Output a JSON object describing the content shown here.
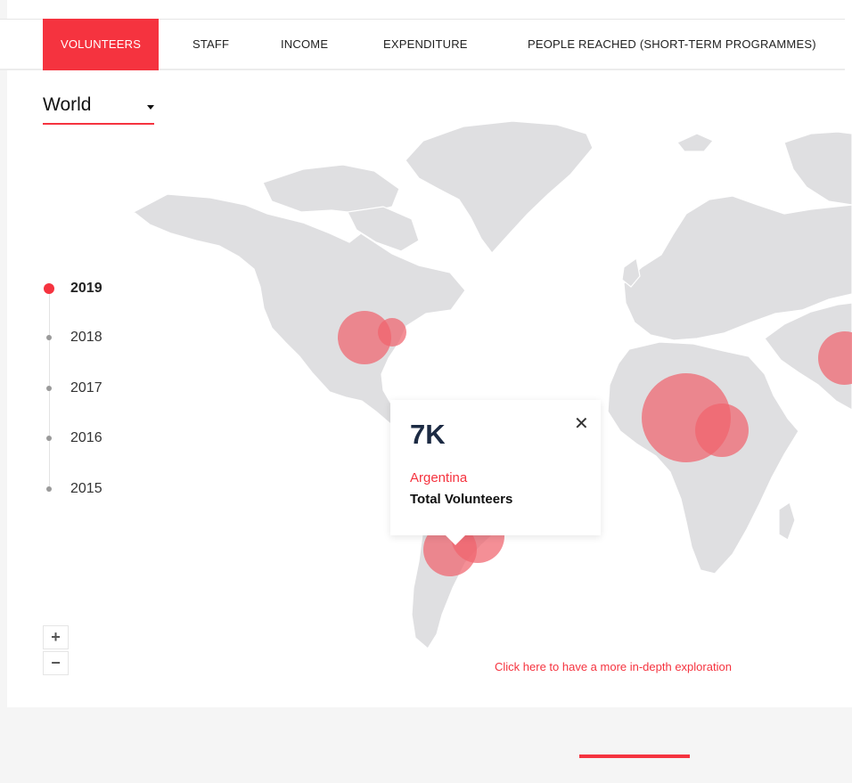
{
  "tabs": [
    {
      "label": "VOLUNTEERS",
      "active": true
    },
    {
      "label": "STAFF",
      "active": false
    },
    {
      "label": "INCOME",
      "active": false
    },
    {
      "label": "EXPENDITURE",
      "active": false
    },
    {
      "label": "PEOPLE REACHED (SHORT-TERM PROGRAMMES)",
      "active": false
    }
  ],
  "region_select": {
    "value": "World"
  },
  "timeline": {
    "years": [
      "2019",
      "2018",
      "2017",
      "2016",
      "2015"
    ],
    "selected": "2019"
  },
  "tooltip": {
    "value": "7K",
    "country": "Argentina",
    "metric": "Total Volunteers",
    "close_icon": "close-icon"
  },
  "zoom": {
    "in_label": "+",
    "out_label": "−"
  },
  "explore_link": "Click here to have a more in-depth exploration",
  "colors": {
    "accent": "#f5333f",
    "land": "#dfdfe1",
    "bubble": "#f0646e"
  }
}
